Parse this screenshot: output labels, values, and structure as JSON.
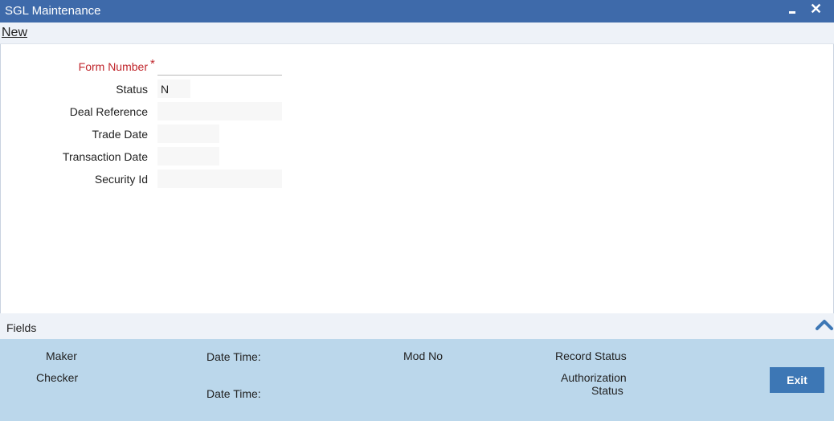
{
  "window": {
    "title": "SGL Maintenance",
    "close_glyph": "✕"
  },
  "toolbar": {
    "new_label": "New"
  },
  "form": {
    "form_number": {
      "label": "Form Number",
      "required_mark": "*",
      "value": ""
    },
    "status": {
      "label": "Status",
      "value": "N"
    },
    "deal_reference": {
      "label": "Deal Reference",
      "value": ""
    },
    "trade_date": {
      "label": "Trade Date",
      "value": ""
    },
    "transaction_date": {
      "label": "Transaction Date",
      "value": ""
    },
    "security_id": {
      "label": "Security Id",
      "value": ""
    }
  },
  "fields_section": {
    "label": "Fields",
    "toggle_icon": "chevron-up-icon"
  },
  "audit": {
    "maker": "Maker",
    "checker": "Checker",
    "date_time_1": "Date Time:",
    "date_time_2": "Date Time:",
    "mod_no": "Mod No",
    "record_status": "Record Status",
    "authorization_status_line1": "Authorization",
    "authorization_status_line2": "Status",
    "exit_label": "Exit"
  },
  "colors": {
    "titlebar": "#3e6aaa",
    "audit_panel": "#bbd7eb",
    "exit_button": "#3d77b5",
    "required": "#c0262c"
  }
}
